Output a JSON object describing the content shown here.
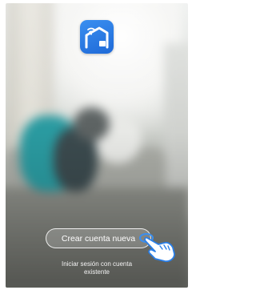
{
  "app": {
    "logo_icon": "smart-home-house-wifi-icon",
    "accent_color": "#2a7fe8"
  },
  "actions": {
    "create_account_label": "Crear cuenta nueva",
    "login_label": "Iniciar sesión con cuenta existente"
  },
  "hint": {
    "icon": "pointing-hand-icon"
  },
  "background": {
    "description_icon": "blurred-home-photo"
  }
}
